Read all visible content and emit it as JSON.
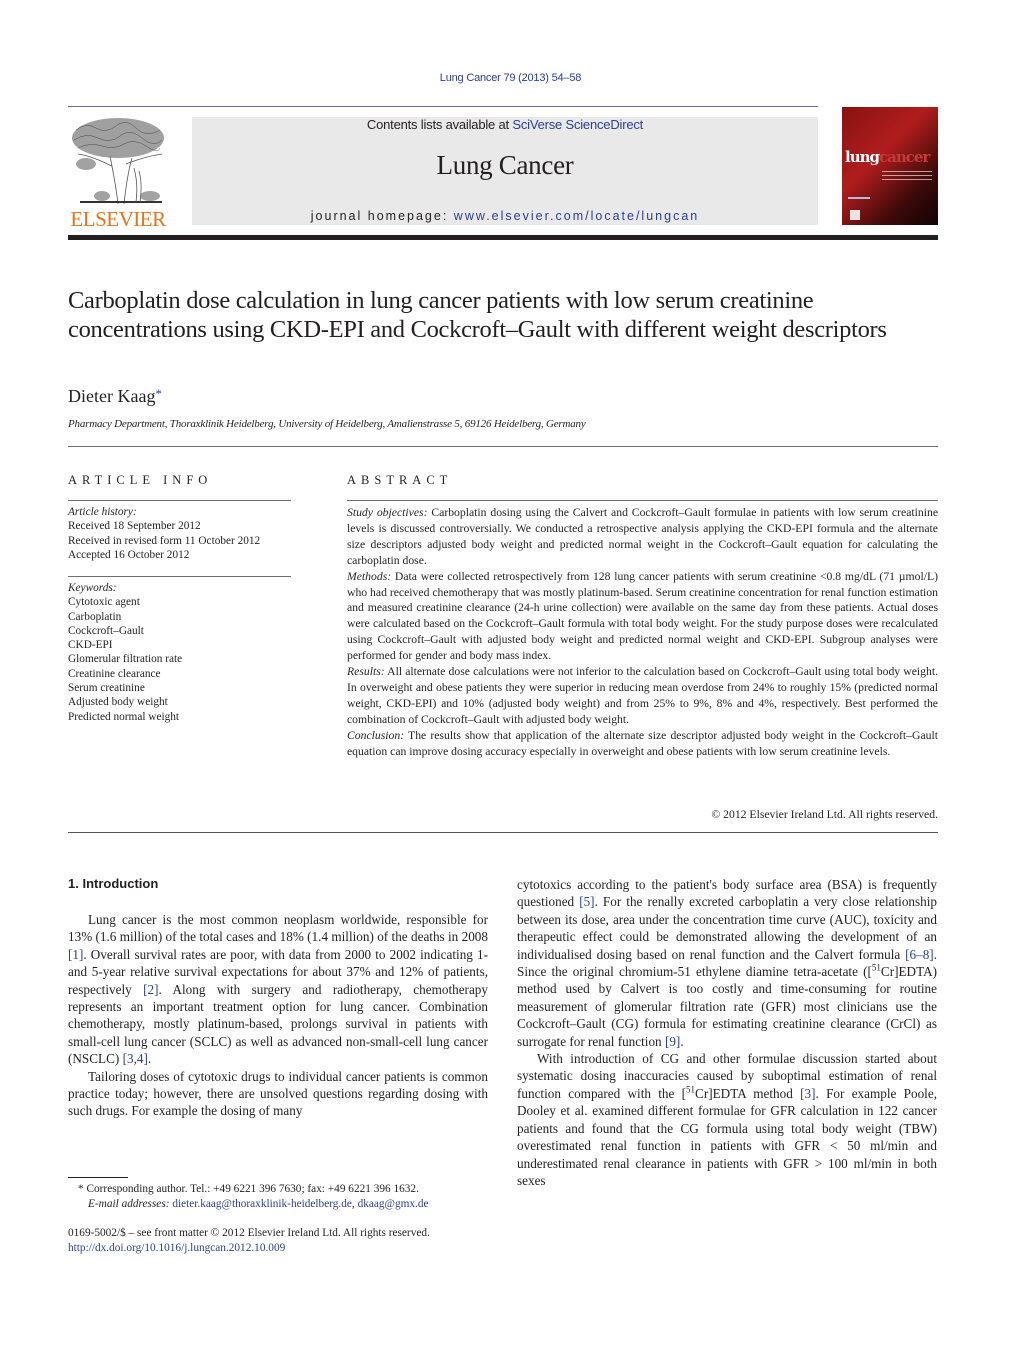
{
  "header": {
    "journal_ref": "Lung Cancer 79 (2013) 54–58",
    "publisher_logo": "ELSEVIER",
    "contents_prefix": "Contents lists available at ",
    "contents_link": "SciVerse ScienceDirect",
    "journal_name": "Lung Cancer",
    "homepage_prefix": "journal homepage: ",
    "homepage_link": "www.elsevier.com/locate/lungcan",
    "cover_title_part1": "lung",
    "cover_title_part2": "cancer"
  },
  "article": {
    "title": "Carboplatin dose calculation in lung cancer patients with low serum creatinine concentrations using CKD-EPI and Cockcroft–Gault with different weight descriptors",
    "author": "Dieter Kaag",
    "author_mark": "*",
    "affiliation": "Pharmacy Department, Thoraxklinik Heidelberg, University of Heidelberg, Amalienstrasse 5, 69126 Heidelberg, Germany"
  },
  "article_info": {
    "heading": "ARTICLE INFO",
    "history_label": "Article history:",
    "history": [
      "Received 18 September 2012",
      "Received in revised form 11 October 2012",
      "Accepted 16 October 2012"
    ],
    "keywords_label": "Keywords:",
    "keywords": [
      "Cytotoxic agent",
      "Carboplatin",
      "Cockcroft–Gault",
      "CKD-EPI",
      "Glomerular filtration rate",
      "Creatinine clearance",
      "Serum creatinine",
      "Adjusted body weight",
      "Predicted normal weight"
    ]
  },
  "abstract": {
    "heading": "ABSTRACT",
    "sections": [
      {
        "label": "Study objectives:",
        "text": " Carboplatin dosing using the Calvert and Cockcroft–Gault formulae in patients with low serum creatinine levels is discussed controversially. We conducted a retrospective analysis applying the CKD-EPI formula and the alternate size descriptors adjusted body weight and predicted normal weight in the Cockcroft–Gault equation for calculating the carboplatin dose."
      },
      {
        "label": "Methods:",
        "text": " Data were collected retrospectively from 128 lung cancer patients with serum creatinine <0.8 mg/dL (71 µmol/L) who had received chemotherapy that was mostly platinum-based. Serum creatinine concentration for renal function estimation and measured creatinine clearance (24-h urine collection) were available on the same day from these patients. Actual doses were calculated based on the Cockcroft–Gault formula with total body weight. For the study purpose doses were recalculated using Cockcroft–Gault with adjusted body weight and predicted normal weight and CKD-EPI. Subgroup analyses were performed for gender and body mass index."
      },
      {
        "label": "Results:",
        "text": " All alternate dose calculations were not inferior to the calculation based on Cockcroft–Gault using total body weight. In overweight and obese patients they were superior in reducing mean overdose from 24% to roughly 15% (predicted normal weight, CKD-EPI) and 10% (adjusted body weight) and from 25% to 9%, 8% and 4%, respectively. Best performed the combination of Cockcroft–Gault with adjusted body weight."
      },
      {
        "label": "Conclusion:",
        "text": " The results show that application of the alternate size descriptor adjusted body weight in the Cockcroft–Gault equation can improve dosing accuracy especially in overweight and obese patients with low serum creatinine levels."
      }
    ],
    "copyright": "© 2012 Elsevier Ireland Ltd. All rights reserved."
  },
  "body": {
    "section_title": "1.  Introduction",
    "left": {
      "p1_a": "Lung cancer is the most common neoplasm worldwide, responsible for 13% (1.6 million) of the total cases and 18% (1.4 million) of the deaths in 2008 ",
      "p1_ref1": "[1]",
      "p1_b": ". Overall survival rates are poor, with data from 2000 to 2002 indicating 1- and 5-year relative survival expectations for about 37% and 12% of patients, respectively ",
      "p1_ref2": "[2]",
      "p1_c": ". Along with surgery and radiotherapy, chemotherapy represents an important treatment option for lung cancer. Combination chemotherapy, mostly platinum-based, prolongs survival in patients with small-cell lung cancer (SCLC) as well as advanced non-small-cell lung cancer (NSCLC) ",
      "p1_ref3": "[3,4]",
      "p1_d": ".",
      "p2": "Tailoring doses of cytotoxic drugs to individual cancer patients is common practice today; however, there are unsolved questions regarding dosing with such drugs. For example the dosing of many"
    },
    "right": {
      "p1_a": "cytotoxics according to the patient's body surface area (BSA) is frequently questioned ",
      "p1_ref1": "[5]",
      "p1_b": ". For the renally excreted carboplatin a very close relationship between its dose, area under the concentration time curve (AUC), toxicity and therapeutic effect could be demonstrated allowing the development of an individualised dosing based on renal function and the Calvert formula ",
      "p1_ref2": "[6–8]",
      "p1_c": ". Since the original chromium-51 ethylene diamine tetra-acetate ([",
      "p1_sup": "51",
      "p1_d": "Cr]EDTA) method used by Calvert is too costly and time-consuming for routine measurement of glomerular filtration rate (GFR) most clinicians use the Cockcroft–Gault (CG) formula for estimating creatinine clearance (CrCl) as surrogate for renal function ",
      "p1_ref3": "[9]",
      "p1_e": ".",
      "p2_a": "With introduction of CG and other formulae discussion started about systematic dosing inaccuracies caused by suboptimal estimation of renal function compared with the [",
      "p2_sup": "51",
      "p2_b": "Cr]EDTA method ",
      "p2_ref1": "[3]",
      "p2_c": ". For example Poole, Dooley et al. examined different formulae for GFR calculation in 122 cancer patients and found that the CG formula using total body weight (TBW) overestimated renal function in patients with GFR < 50 ml/min and underestimated renal clearance in patients with GFR > 100 ml/min in both sexes"
    }
  },
  "footnotes": {
    "mark": "*",
    "corresponding": " Corresponding author. Tel.: +49 6221 396 7630; fax: +49 6221 396 1632.",
    "email_label": "E-mail addresses:",
    "email1": "dieter.kaag@thoraxklinik-heidelberg.de",
    "email_sep": ", ",
    "email2": "dkaag@gmx.de",
    "front_matter": "0169-5002/$ – see front matter © 2012 Elsevier Ireland Ltd. All rights reserved.",
    "doi": "http://dx.doi.org/10.1016/j.lungcan.2012.10.009"
  }
}
